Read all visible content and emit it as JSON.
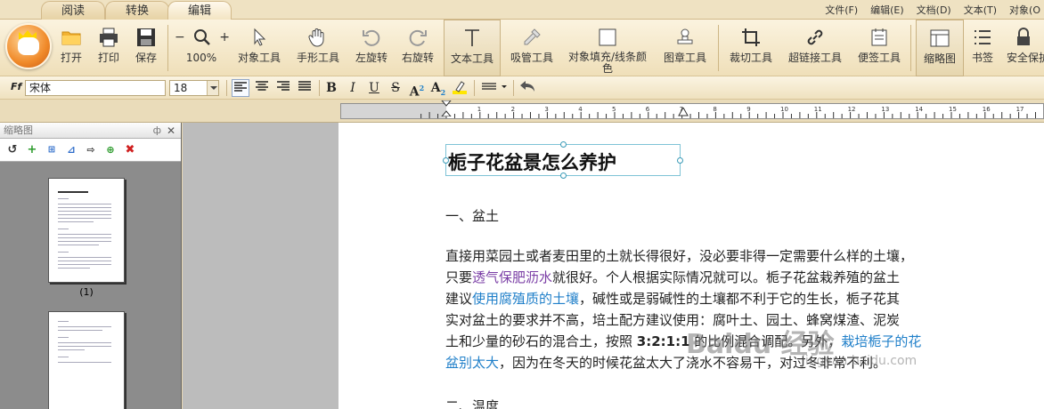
{
  "tabs": [
    {
      "label": "阅读",
      "active": false
    },
    {
      "label": "转换",
      "active": false
    },
    {
      "label": "编辑",
      "active": true
    }
  ],
  "menus": [
    "文件(F)",
    "编辑(E)",
    "文档(D)",
    "文本(T)",
    "对象(O"
  ],
  "ribbon": {
    "open": "打开",
    "print": "打印",
    "save": "保存",
    "zoom_level": "100%",
    "object_tool": "对象工具",
    "hand_tool": "手形工具",
    "rotate_left": "左旋转",
    "rotate_right": "右旋转",
    "text_tool": "文本工具",
    "eyedropper": "吸管工具",
    "fill_stroke": "对象填充/线条颜色",
    "stamp_tool": "图章工具",
    "crop_tool": "裁切工具",
    "link_tool": "超链接工具",
    "note_tool": "便签工具",
    "thumbnails": "缩略图",
    "bookmarks": "书签",
    "security": "安全保护"
  },
  "format": {
    "font_name": "宋体",
    "font_size": "18",
    "bold": "B",
    "italic": "I",
    "underline": "U",
    "strike": "S",
    "superscript": "A",
    "subscript": "A",
    "sup_mark": "2",
    "sub_mark": "2"
  },
  "ruler": {
    "ticks": [
      "1",
      "2",
      "3",
      "4",
      "5",
      "6",
      "7",
      "8",
      "9",
      "10",
      "11",
      "12",
      "13",
      "14",
      "15",
      "16",
      "17"
    ]
  },
  "thumb_panel": {
    "title": "缩略图",
    "pin": "ф",
    "close": "✕",
    "pages": [
      "(1)"
    ]
  },
  "document": {
    "title": "栀子花盆景怎么养护",
    "section1": "一、盆土",
    "lines": [
      {
        "parts": [
          {
            "t": "直接用菜园土或者麦田里的土就长得很好，没必要非得一定需要什么样的土壤，"
          }
        ]
      },
      {
        "parts": [
          {
            "t": "只要"
          },
          {
            "t": "透气保肥沥水",
            "c": "hl-purple"
          },
          {
            "t": "就很好。个人根据实际情况就可以。栀子花盆栽养殖的盆土"
          }
        ]
      },
      {
        "parts": [
          {
            "t": "建议"
          },
          {
            "t": "使用腐殖质的土壤",
            "c": "hl-blue"
          },
          {
            "t": "，碱性或是弱碱性的土壤都不利于它的生长，栀子花其"
          }
        ]
      },
      {
        "parts": [
          {
            "t": "实对盆土的要求并不高，培土配方建议使用：腐叶土、园土、蜂窝煤渣、泥炭"
          }
        ]
      },
      {
        "parts": [
          {
            "t": "土和少量的砂石的混合土，按照 "
          },
          {
            "t": "3:2:1:1",
            "c": "bold"
          },
          {
            "t": " 的比例混合调配。另外，"
          },
          {
            "t": "栽培栀子的花",
            "c": "hl-blue"
          }
        ]
      },
      {
        "parts": [
          {
            "t": "盆别太大",
            "c": "hl-blue"
          },
          {
            "t": "，因为在冬天的时候花盆太大了浇水不容易干，对过冬非常不利。"
          }
        ]
      }
    ],
    "section2": "二、温度"
  },
  "watermark": {
    "main": "Baidu 经验",
    "sub": "jingyan.baidu.com"
  }
}
